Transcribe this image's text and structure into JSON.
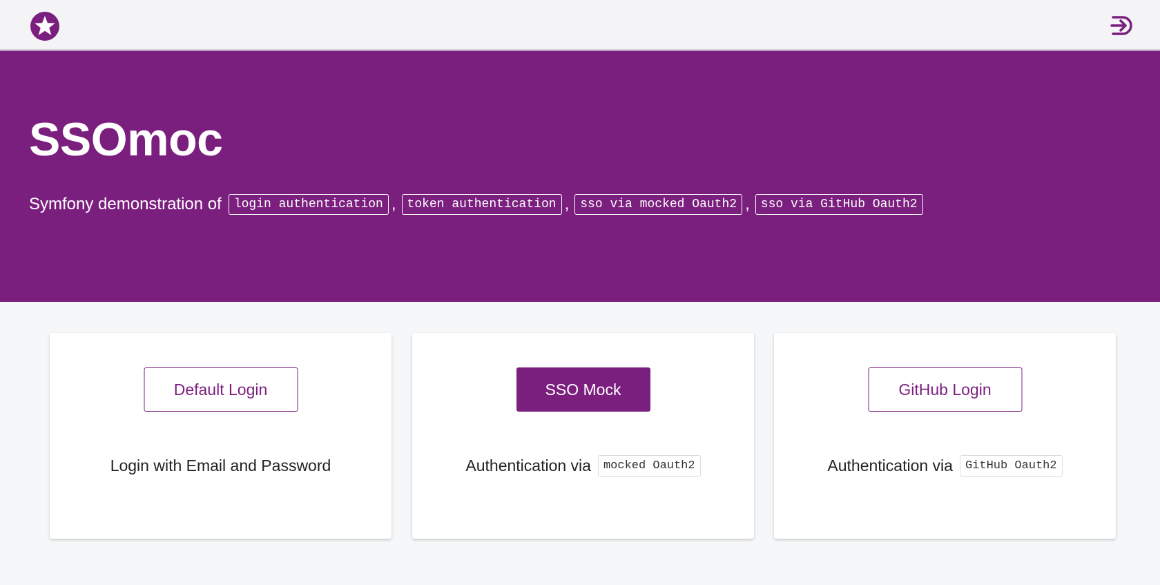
{
  "colors": {
    "brand": "#7b1f7f",
    "navbar_bg": "#f4f4f6",
    "page_bg": "#f5f7f9",
    "card_bg": "#ffffff"
  },
  "navbar": {
    "logo_icon": "star-in-circle-icon",
    "logout_icon": "logout-arrow-icon"
  },
  "hero": {
    "title": "SSOmoc",
    "subtitle_lead": "Symfony demonstration of",
    "features": [
      "login authentication",
      "token authentication",
      "sso via mocked Oauth2",
      "sso via GitHub Oauth2"
    ],
    "separator": ","
  },
  "cards": [
    {
      "button_label": "Default Login",
      "text": "Login with Email and Password",
      "code": ""
    },
    {
      "button_label": "SSO Mock",
      "text": "Authentication via",
      "code": "mocked Oauth2"
    },
    {
      "button_label": "GitHub Login",
      "text": "Authentication via",
      "code": "GitHub Oauth2"
    }
  ]
}
